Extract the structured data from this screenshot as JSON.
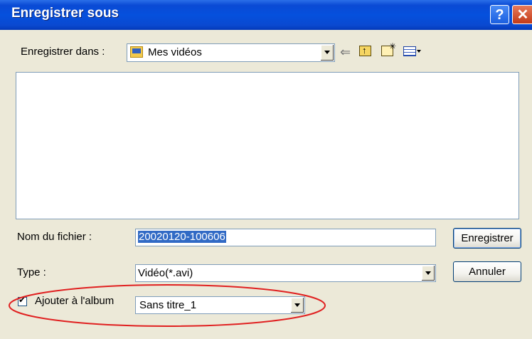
{
  "window": {
    "title": "Enregistrer sous",
    "help_glyph": "?",
    "close_glyph": "✕"
  },
  "lookin": {
    "label": "Enregistrer dans :",
    "value": "Mes vidéos"
  },
  "toolbar": {
    "back_glyph": "⇐",
    "icons": [
      "back-icon",
      "up-folder-icon",
      "new-folder-icon",
      "views-menu-icon"
    ]
  },
  "filename": {
    "label": "Nom du fichier :",
    "value": "20020120-100606"
  },
  "filetype": {
    "label": "Type :",
    "value": "Vidéo(*.avi)"
  },
  "album": {
    "checkbox_label": "Ajouter à l'album",
    "checked": true,
    "value": "Sans titre_1"
  },
  "buttons": {
    "save_label": "Enregistrer",
    "cancel_label": "Annuler"
  },
  "colors": {
    "titlebar": "#0550dd",
    "selection": "#316ac5",
    "annotation": "#e02020"
  }
}
